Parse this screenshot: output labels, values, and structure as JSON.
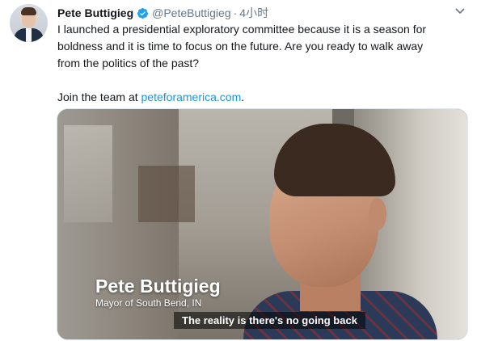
{
  "author": {
    "name": "Pete Buttigieg",
    "handle": "@PeteButtigieg",
    "separator": "·",
    "time": "4小时",
    "verified": true
  },
  "tweet": {
    "body": "I launched a presidential exploratory committee because it is a season for boldness and it is time to focus on the future. Are you ready to walk away from the politics of the past?",
    "join_prefix": "Join the team at ",
    "link_text": "peteforamerica.com",
    "join_suffix": "."
  },
  "media": {
    "caption_name": "Pete Buttigieg",
    "caption_title": "Mayor of South Bend, IN",
    "subtitle": "The reality is there's no going back"
  },
  "icons": {
    "verified": "verified-badge-icon",
    "caret": "chevron-down-icon"
  },
  "colors": {
    "link": "#1b95e0",
    "verified": "#1da1f2",
    "secondary_text": "#657786"
  }
}
